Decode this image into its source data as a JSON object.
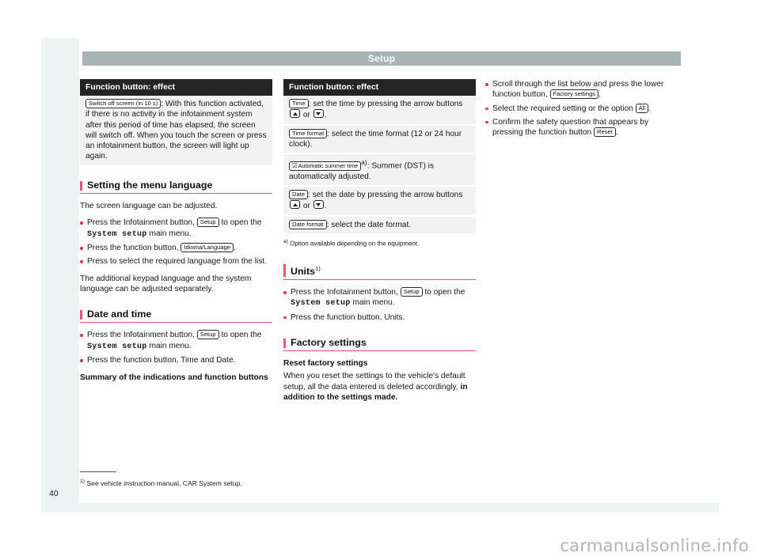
{
  "header": {
    "chapter_title": "Setup"
  },
  "page": {
    "number": "40",
    "footnote_marker": "1)",
    "footnote_text": "See vehicle instruction manual, CAR System setup.",
    "watermark": "carmanualsonline.info",
    "accent_color": "#f1536e",
    "bullet_color": "#e8334a",
    "header_bg": "#a6b4b4",
    "table_head_bg": "#242424",
    "table_row_bg": "#f2f2f2"
  },
  "column1": {
    "table": {
      "header": "Function button: effect",
      "rows": [
        {
          "chip": "Switch off screen (in 10 s)",
          "text": ": With this function activated, if there is no activity in the infotainment system after this period of time has elapsed, the screen will switch off. When you touch the screen or press an infotainment button, the screen will light up again."
        }
      ]
    },
    "section_language": {
      "heading": "Setting the menu language",
      "intro": "The screen language can be adjusted.",
      "bullets": [
        {
          "pre": "Press the Infotainment button, ",
          "chip": "Setup",
          "mid": " to open the ",
          "mono": "System setup",
          "post": " main menu."
        },
        {
          "pre": "Press the function button, ",
          "chip": "Idioma/Language",
          "post": "."
        },
        {
          "pre": "Press to select the required language from the list."
        }
      ],
      "closing": "The additional keypad language and the system language can be adjusted separately."
    },
    "section_datetime": {
      "heading": "Date and time",
      "bullets": [
        {
          "pre": "Press the Infotainment button, ",
          "chip": "Setup",
          "mid": " to open the ",
          "mono": "System setup",
          "post": " main menu."
        },
        {
          "pre": "Press the function button, Time and Date."
        }
      ],
      "subheading": "Summary of the indications and function buttons"
    }
  },
  "column2": {
    "table": {
      "header": "Function button: effect",
      "rows": [
        {
          "chip": "Time",
          "text_before": ": set the time by pressing the arrow buttons ",
          "arrow_up": "up-arrow",
          "text_mid": " or ",
          "arrow_down": "down-arrow",
          "text_after": "."
        },
        {
          "chip": "Time format",
          "text_before": ": select the time format (12 or 24 hour clock)."
        },
        {
          "chip": "Automatic summer time",
          "checkbox": "☑",
          "sup": "a)",
          "text_before": ": Summer (DST) is automatically adjusted."
        },
        {
          "chip": "Date",
          "text_before": ": set the date by pressing the arrow buttons ",
          "arrow_up": "up-arrow",
          "text_mid": " or ",
          "arrow_down": "down-arrow",
          "text_after": "."
        },
        {
          "chip": "Date format",
          "text_before": ": select the date format."
        }
      ],
      "footnote_marker": "a)",
      "footnote": "Option available depending on the equipment."
    },
    "section_units": {
      "heading": "Units",
      "heading_sup": "1)",
      "bullets": [
        {
          "pre": "Press the Infotainment button, ",
          "chip": "Setup",
          "mid": " to open the ",
          "mono": "System setup",
          "post": " main menu."
        },
        {
          "pre": "Press the function button, Units."
        }
      ]
    },
    "section_factory": {
      "heading": "Factory settings",
      "subheading": "Reset factory settings",
      "body_pre": "When you reset the settings to the vehicle's default setup, all the data entered is deleted accordingly, ",
      "body_bold": "in addition to the settings made",
      "body_post": "."
    }
  },
  "column3": {
    "bullets": [
      {
        "pre": "Scroll through the list below and press the lower function button, ",
        "chip": "Factory settings",
        "post": "."
      },
      {
        "pre": "Select the required setting or the option ",
        "chip": "All",
        "post": "."
      },
      {
        "pre": "Confirm the safety question that appears by pressing the function button ",
        "chip": "Reset",
        "post": "."
      }
    ]
  }
}
